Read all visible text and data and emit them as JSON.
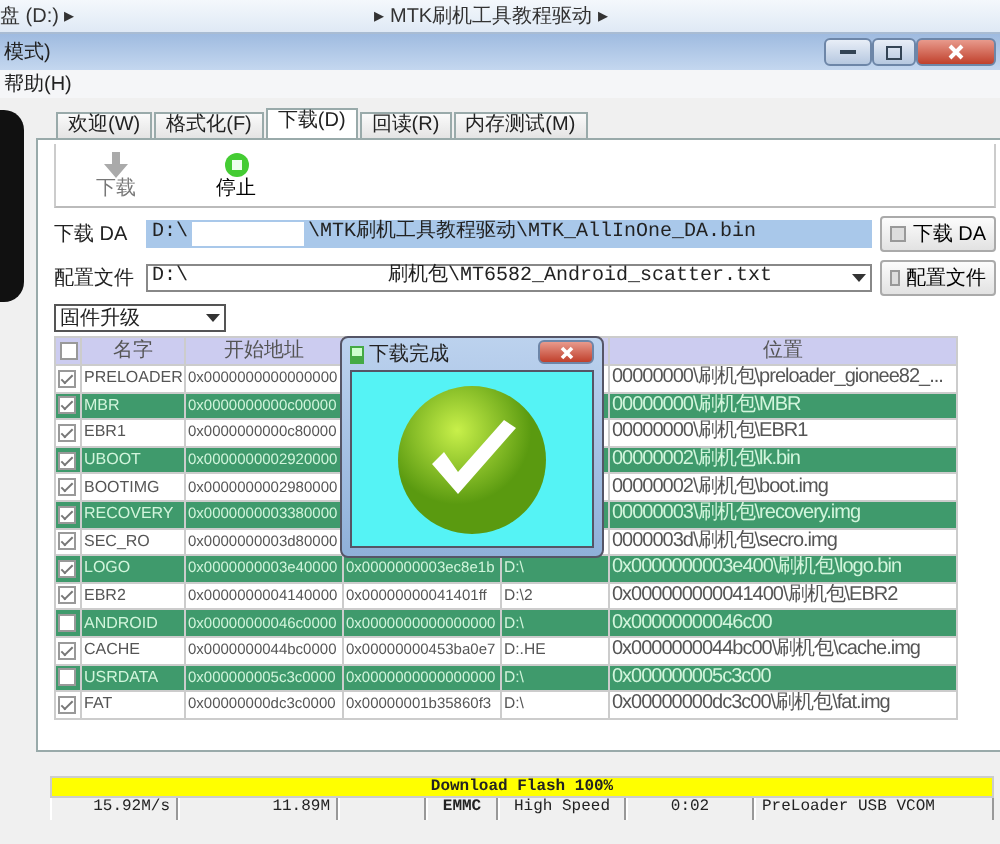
{
  "explorer_bar": {
    "breadcrumbs": [
      "盘 (D:) ▸",
      "▸ MTK刷机工具教程驱动 ▸"
    ]
  },
  "window": {
    "title": "模式)"
  },
  "menu": [
    "帮助(H)"
  ],
  "tabs": [
    {
      "label": "欢迎(W)",
      "selected": false
    },
    {
      "label": "格式化(F)",
      "selected": false
    },
    {
      "label": "下载(D)",
      "selected": true
    },
    {
      "label": "回读(R)",
      "selected": false
    },
    {
      "label": "内存测试(M)",
      "selected": false
    }
  ],
  "toolbar": [
    {
      "label": "下载",
      "kind": "download",
      "disabled": true
    },
    {
      "label": "停止",
      "kind": "stop",
      "disabled": false
    }
  ],
  "da_field": {
    "label": "下载 DA",
    "value_prefix": "D:\\",
    "value_suffix": "\\MTK刷机工具教程驱动\\MTK_AllInOne_DA.bin",
    "button": "下载 DA"
  },
  "scatter_field": {
    "label": "配置文件",
    "value_prefix": "D:\\",
    "value_suffix": "刷机包\\MT6582_Android_scatter.txt",
    "button": "配置文件"
  },
  "mode_select": {
    "value": "固件升级"
  },
  "table": {
    "header": {
      "checked": false,
      "name": "名字",
      "start": "开始地址",
      "location": "位置"
    },
    "rows": [
      {
        "checked": true,
        "highlighted": false,
        "name": "PRELOADER",
        "start": "0x0000000000000000",
        "location": "00000000\\刷机包\\preloader_gionee82_..."
      },
      {
        "checked": true,
        "highlighted": true,
        "name": "MBR",
        "start": "0x0000000000c00000",
        "location": "00000000\\刷机包\\MBR"
      },
      {
        "checked": true,
        "highlighted": false,
        "name": "EBR1",
        "start": "0x0000000000c80000",
        "location": "00000000\\刷机包\\EBR1"
      },
      {
        "checked": true,
        "highlighted": true,
        "name": "UBOOT",
        "start": "0x0000000002920000",
        "location": "00000002\\刷机包\\lk.bin"
      },
      {
        "checked": true,
        "highlighted": false,
        "name": "BOOTIMG",
        "start": "0x0000000002980000",
        "location": "00000002\\刷机包\\boot.img"
      },
      {
        "checked": true,
        "highlighted": true,
        "name": "RECOVERY",
        "start": "0x0000000003380000",
        "location": "00000003\\刷机包\\recovery.img"
      },
      {
        "checked": true,
        "highlighted": false,
        "name": "SEC_RO",
        "start": "0x0000000003d80000",
        "location": "0000003d\\刷机包\\secro.img"
      },
      {
        "checked": true,
        "highlighted": true,
        "name": "LOGO",
        "start": "0x0000000003e40000",
        "end": "0x0000000003ec8e1b",
        "region": "D:\\",
        "location": "0x0000000003e400\\刷机包\\logo.bin"
      },
      {
        "checked": true,
        "highlighted": false,
        "name": "EBR2",
        "start": "0x0000000004140000",
        "end": "0x00000000041401ff",
        "region": "D:\\2",
        "location": "0x000000000041400\\刷机包\\EBR2"
      },
      {
        "checked": false,
        "highlighted": true,
        "name": "ANDROID",
        "start": "0x00000000046c0000",
        "end": "0x0000000000000000",
        "region": "D:\\",
        "location": "0x00000000046c00"
      },
      {
        "checked": true,
        "highlighted": false,
        "name": "CACHE",
        "start": "0x0000000044bc0000",
        "end": "0x00000000453ba0e7",
        "region": "D:.HE",
        "location": "0x0000000044bc00\\刷机包\\cache.img"
      },
      {
        "checked": false,
        "highlighted": true,
        "name": "USRDATA",
        "start": "0x000000005c3c0000",
        "end": "0x0000000000000000",
        "region": "D:\\",
        "location": "0x000000005c3c00"
      },
      {
        "checked": true,
        "highlighted": false,
        "name": "FAT",
        "start": "0x00000000dc3c0000",
        "end": "0x00000001b35860f3",
        "region": "D:\\",
        "location": "0x00000000dc3c00\\刷机包\\fat.img"
      }
    ]
  },
  "dialog": {
    "title": "下载完成"
  },
  "progress": {
    "label": "Download Flash 100%",
    "level": 1
  },
  "status_bar": [
    "15.92M/s",
    "11.89M",
    "EMMC",
    "High Speed",
    "0:02",
    "PreLoader USB VCOM"
  ]
}
